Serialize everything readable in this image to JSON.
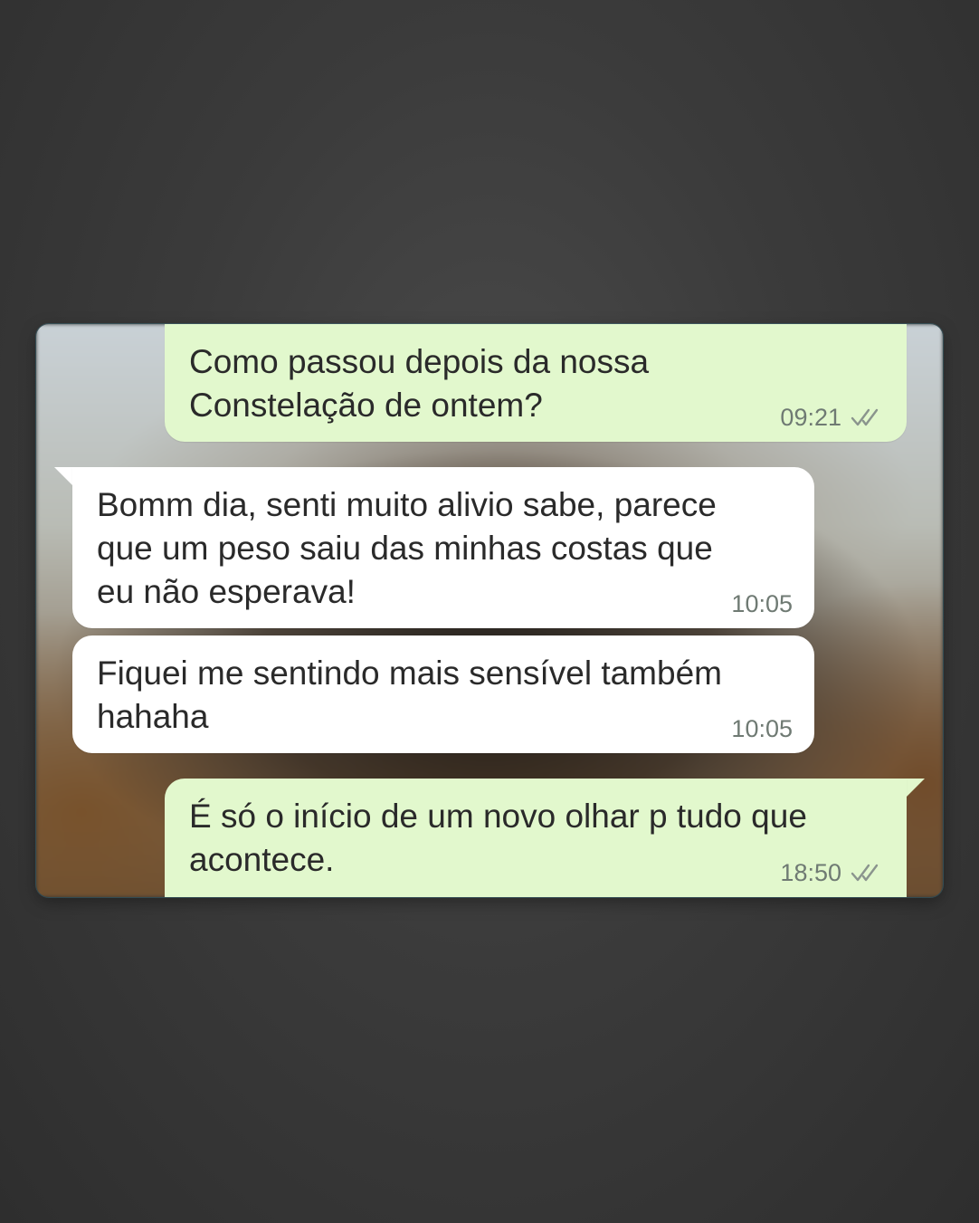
{
  "conversation": {
    "messages": [
      {
        "direction": "outgoing",
        "text": "Como passou depois da nossa\nConstelação de ontem?",
        "time": "09:21",
        "status_icon": "double-check-icon"
      },
      {
        "direction": "incoming",
        "text": "Bomm dia, senti muito alivio sabe, parece\nque um peso saiu das minhas costas que\neu não esperava!",
        "time": "10:05"
      },
      {
        "direction": "incoming",
        "text": "Fiquei me sentindo mais sensível também\nhahaha",
        "time": "10:05"
      },
      {
        "direction": "outgoing",
        "text": "É só o início de um novo olhar p tudo que\nacontece.",
        "time": "18:50",
        "status_icon": "double-check-icon"
      }
    ]
  },
  "colors": {
    "outgoing_bubble": "#e2f8cd",
    "incoming_bubble": "#ffffff",
    "text": "#2a2a2a",
    "timestamp": "#6f7a73",
    "page_background": "#3b3b3b"
  }
}
